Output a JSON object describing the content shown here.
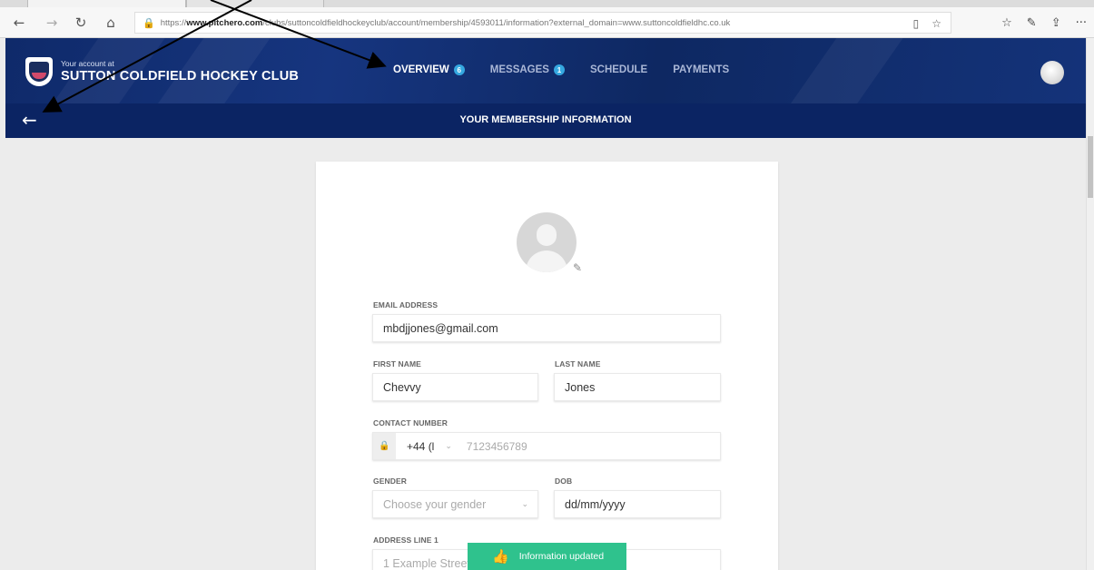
{
  "browser": {
    "toolbar": {
      "back": "←",
      "forward": "→",
      "refresh": "↻",
      "home": "⌂"
    },
    "address": {
      "lock": "🔒",
      "prefix": "https://",
      "domain": "www.pitchero.com",
      "rest": "/clubs/suttoncoldfieldhockeyclub/account/membership/4593011/information?external_domain=www.suttoncoldfieldhc.co.uk"
    },
    "address_icons": {
      "reading": "▯",
      "favorite": "☆"
    },
    "right_icons": {
      "favorites": "☆",
      "notes": "✎",
      "share": "⇪",
      "more": "···"
    }
  },
  "site": {
    "account_label": "Your account at",
    "club_name": "SUTTON COLDFIELD HOCKEY CLUB",
    "nav": [
      {
        "label": "OVERVIEW",
        "badge": "6",
        "active": true
      },
      {
        "label": "MESSAGES",
        "badge": "1",
        "active": false
      },
      {
        "label": "SCHEDULE",
        "badge": "",
        "active": false
      },
      {
        "label": "PAYMENTS",
        "badge": "",
        "active": false
      }
    ],
    "back_arrow": "←",
    "subtitle": "YOUR MEMBERSHIP INFORMATION"
  },
  "form": {
    "edit_icon": "✎",
    "email": {
      "label": "EMAIL ADDRESS",
      "value": "mbdjjones@gmail.com"
    },
    "first_name": {
      "label": "FIRST NAME",
      "value": "Chevvy"
    },
    "last_name": {
      "label": "LAST NAME",
      "value": "Jones"
    },
    "contact": {
      "label": "CONTACT NUMBER",
      "lock": "🔒",
      "code": "+44 (l",
      "chevron": "⌄",
      "placeholder": "7123456789"
    },
    "gender": {
      "label": "GENDER",
      "placeholder": "Choose your gender",
      "chevron": "⌄"
    },
    "dob": {
      "label": "DOB",
      "placeholder": "dd/mm/yyyy"
    },
    "address1": {
      "label": "ADDRESS LINE 1",
      "placeholder": "1 Example Street"
    }
  },
  "toast": {
    "icon": "👍",
    "text": "Information updated"
  },
  "colors": {
    "header": "#0f2a6a",
    "subbar": "#0b2463",
    "badge": "#35a8e0",
    "toast": "#2fc28d"
  }
}
